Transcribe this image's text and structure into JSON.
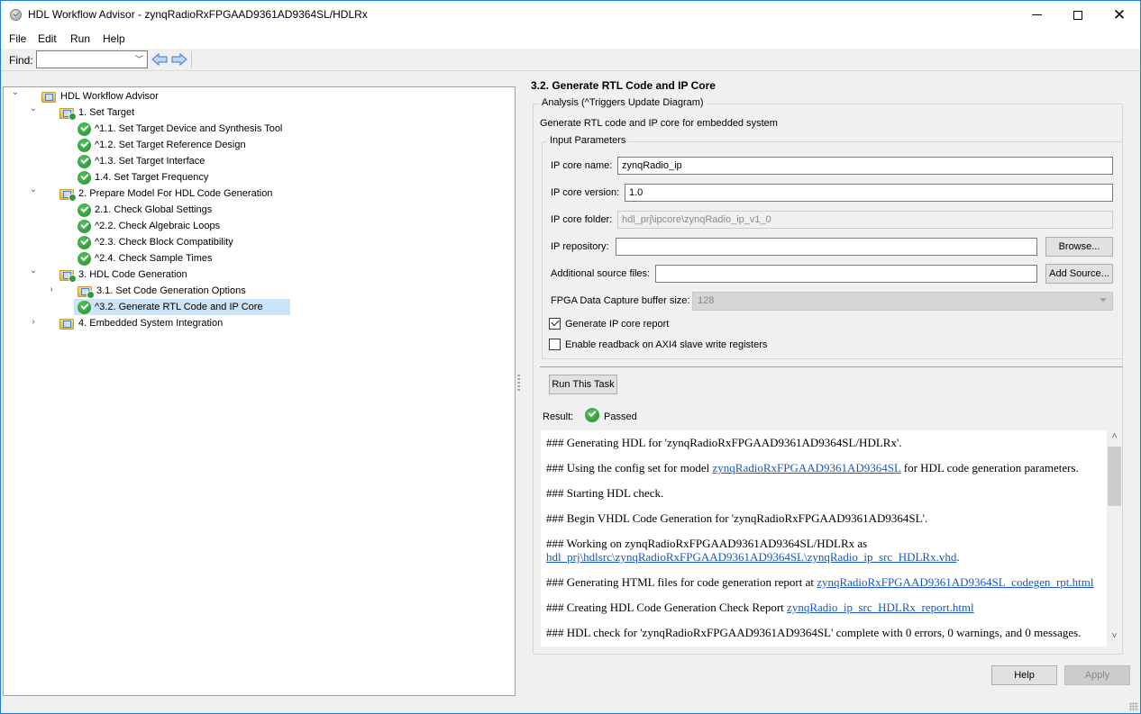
{
  "window": {
    "title": "HDL Workflow Advisor - zynqRadioRxFPGAAD9361AD9364SL/HDLRx",
    "controls": {
      "minimize": "minimize-icon",
      "maximize": "maximize-icon",
      "close": "close-icon"
    }
  },
  "menu": {
    "items": [
      "File",
      "Edit",
      "Run",
      "Help"
    ]
  },
  "toolbar": {
    "find_label": "Find:",
    "find_value": "",
    "back_icon": "arrow-left-icon",
    "forward_icon": "arrow-right-icon"
  },
  "tree": {
    "items": [
      {
        "label": "HDL Workflow Advisor",
        "level": 0,
        "expanded": true,
        "icon": "folder-icon",
        "status": "none"
      },
      {
        "label": "1. Set Target",
        "level": 1,
        "expanded": true,
        "icon": "folder-icon",
        "status": "passed"
      },
      {
        "label": "^1.1. Set Target Device and Synthesis Tool",
        "level": 2,
        "icon": "check-icon",
        "status": "passed"
      },
      {
        "label": "^1.2. Set Target Reference Design",
        "level": 2,
        "icon": "check-icon",
        "status": "passed"
      },
      {
        "label": "^1.3. Set Target Interface",
        "level": 2,
        "icon": "check-icon",
        "status": "passed"
      },
      {
        "label": "1.4. Set Target Frequency",
        "level": 2,
        "icon": "check-icon",
        "status": "passed"
      },
      {
        "label": "2. Prepare Model For HDL Code Generation",
        "level": 1,
        "expanded": true,
        "icon": "folder-icon",
        "status": "passed"
      },
      {
        "label": "2.1. Check Global Settings",
        "level": 2,
        "icon": "check-icon",
        "status": "passed"
      },
      {
        "label": "^2.2. Check Algebraic Loops",
        "level": 2,
        "icon": "check-icon",
        "status": "passed"
      },
      {
        "label": "^2.3. Check Block Compatibility",
        "level": 2,
        "icon": "check-icon",
        "status": "passed"
      },
      {
        "label": "^2.4. Check Sample Times",
        "level": 2,
        "icon": "check-icon",
        "status": "passed"
      },
      {
        "label": "3. HDL Code Generation",
        "level": 1,
        "expanded": true,
        "icon": "folder-icon",
        "status": "passed"
      },
      {
        "label": "3.1. Set Code Generation Options",
        "level": 2,
        "expanded": false,
        "icon": "folder-icon",
        "status": "passed"
      },
      {
        "label": "^3.2. Generate RTL Code and IP Core",
        "level": 2,
        "icon": "check-icon",
        "status": "passed",
        "selected": true
      },
      {
        "label": "4. Embedded System Integration",
        "level": 1,
        "expanded": false,
        "icon": "folder-icon",
        "status": "none"
      }
    ]
  },
  "task": {
    "title": "3.2. Generate RTL Code and IP Core",
    "analysis_legend": "Analysis (^Triggers Update Diagram)",
    "description": "Generate RTL code and IP core for embedded system",
    "params_legend": "Input Parameters",
    "fields": {
      "ip_core_name": {
        "label": "IP core name:",
        "value": "zynqRadio_ip"
      },
      "ip_core_version": {
        "label": "IP core version:",
        "value": "1.0"
      },
      "ip_core_folder": {
        "label": "IP core folder:",
        "value": "hdl_prj\\ipcore\\zynqRadio_ip_v1_0"
      },
      "ip_repository": {
        "label": "IP repository:",
        "value": "",
        "button": "Browse..."
      },
      "additional_sources": {
        "label": "Additional source files:",
        "value": "",
        "button": "Add Source..."
      },
      "capture_buffer": {
        "label": "FPGA Data Capture buffer size:",
        "value": "128"
      }
    },
    "checkboxes": [
      {
        "label": "Generate IP core report",
        "checked": true
      },
      {
        "label": "Enable readback on AXI4 slave write registers",
        "checked": false
      }
    ],
    "run_button": "Run This Task",
    "result_label": "Result:",
    "result_value": "Passed",
    "log": [
      {
        "text": "### Generating HDL for 'zynqRadioRxFPGAAD9361AD9364SL/HDLRx'."
      },
      {
        "pre": "### Using the config set for model ",
        "link": "zynqRadioRxFPGAAD9361AD9364SL",
        "post": " for HDL code generation parameters."
      },
      {
        "text": "### Starting HDL check."
      },
      {
        "text": "### Begin VHDL Code Generation for 'zynqRadioRxFPGAAD9361AD9364SL'."
      },
      {
        "pre": "### Working on zynqRadioRxFPGAAD9361AD9364SL/HDLRx as ",
        "link": "hdl_prj\\hdlsrc\\zynqRadioRxFPGAAD9361AD9364SL\\zynqRadio_ip_src_HDLRx.vhd",
        "post": "."
      },
      {
        "pre": "### Generating HTML files for code generation report at ",
        "link": "zynqRadioRxFPGAAD9361AD9364SL_codegen_rpt.html",
        "post": ""
      },
      {
        "pre": "### Creating HDL Code Generation Check Report ",
        "link": "zynqRadio_ip_src_HDLRx_report.html",
        "post": ""
      },
      {
        "text": "### HDL check for 'zynqRadioRxFPGAAD9361AD9364SL' complete with 0 errors, 0 warnings, and 0 messages."
      }
    ]
  },
  "footer": {
    "help": "Help",
    "apply": "Apply"
  }
}
